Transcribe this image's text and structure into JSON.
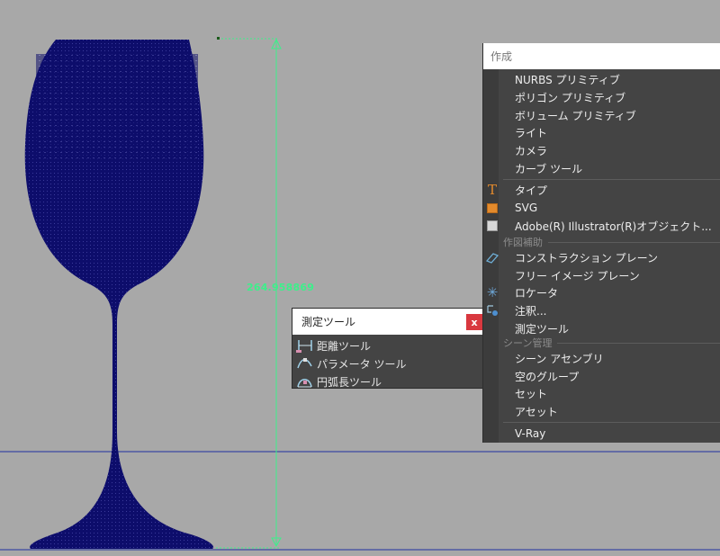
{
  "viewport": {
    "dimension_value": "264.958869",
    "colors": {
      "background": "#a8a8a8",
      "glass": "#0d0d6b",
      "measure_line": "#3cf08a",
      "guide_line": "#1f2f9f"
    }
  },
  "measure_window": {
    "title": "測定ツール",
    "close_label": "x",
    "items": [
      {
        "label": "距離ツール",
        "icon": "distance-tool-icon"
      },
      {
        "label": "パラメータ ツール",
        "icon": "parameter-tool-icon"
      },
      {
        "label": "円弧長ツール",
        "icon": "arc-length-tool-icon"
      }
    ]
  },
  "create_menu": {
    "title": "作成",
    "items": [
      {
        "label": "NURBS プリミティブ"
      },
      {
        "label": "ポリゴン プリミティブ"
      },
      {
        "label": "ボリューム プリミティブ"
      },
      {
        "label": "ライト"
      },
      {
        "label": "カメラ"
      },
      {
        "label": "カーブ ツール"
      },
      {
        "label": "タイプ",
        "icon": "type-icon"
      },
      {
        "label": "SVG",
        "icon": "svg-icon"
      },
      {
        "label": "Adobe(R) Illustrator(R)オブジェクト...",
        "icon": "illustrator-icon"
      },
      {
        "label": "コンストラクション プレーン",
        "icon": "construction-plane-icon"
      },
      {
        "label": "フリー イメージ プレーン"
      },
      {
        "label": "ロケータ",
        "icon": "locator-icon"
      },
      {
        "label": "注釈...",
        "icon": "annotation-icon"
      },
      {
        "label": "測定ツール"
      },
      {
        "label": "シーン アセンブリ"
      },
      {
        "label": "空のグループ"
      },
      {
        "label": "セット"
      },
      {
        "label": "アセット"
      },
      {
        "label": "V-Ray"
      }
    ],
    "sections": {
      "construction_aids": "作図補助",
      "scene_management": "シーン管理"
    }
  }
}
